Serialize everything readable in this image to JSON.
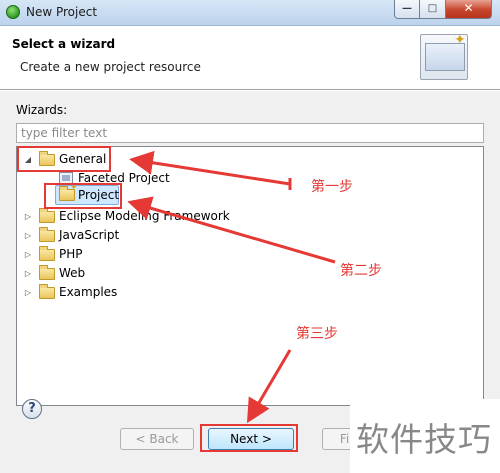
{
  "window": {
    "title": "New Project",
    "min_glyph": "—",
    "max_glyph": "□",
    "close_glyph": "✕"
  },
  "header": {
    "title": "Select a wizard",
    "description": "Create a new project resource"
  },
  "wizards": {
    "label": "Wizards:",
    "filter_placeholder": "type filter text",
    "tree": {
      "general": "General",
      "faceted_project": "Faceted Project",
      "project": "Project",
      "eclipse_modeling": "Eclipse Modeling Framework",
      "javascript": "JavaScript",
      "php": "PHP",
      "web": "Web",
      "examples": "Examples"
    }
  },
  "annotations": {
    "step1": "第一步",
    "step2": "第二步",
    "step3": "第三步"
  },
  "buttons": {
    "help": "?",
    "back": "< Back",
    "next": "Next >",
    "finish": "Finish"
  },
  "watermark": "软件技巧",
  "colors": {
    "annotation": "#e53935",
    "selection": "#cde8ff"
  }
}
